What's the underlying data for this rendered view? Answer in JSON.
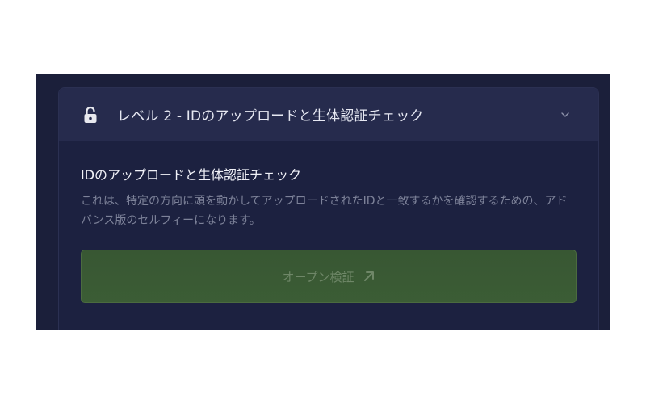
{
  "card": {
    "header": {
      "title": "レベル 2 - IDのアップロードと生体認証チェック",
      "lock_icon": "lock-open-icon",
      "chevron_icon": "chevron-down-icon"
    },
    "body": {
      "title": "IDのアップロードと生体認証チェック",
      "description": "これは、特定の方向に頭を動かしてアップロードされたIDと一致するかを確認するための、アドバンス版のセルフィーになります。",
      "button_label": "オープン検証",
      "button_icon": "arrow-up-right-icon"
    }
  },
  "colors": {
    "background": "#1b1f3a",
    "header": "#262b4d",
    "button": "#3a5a34",
    "button_text": "#6f8768"
  }
}
